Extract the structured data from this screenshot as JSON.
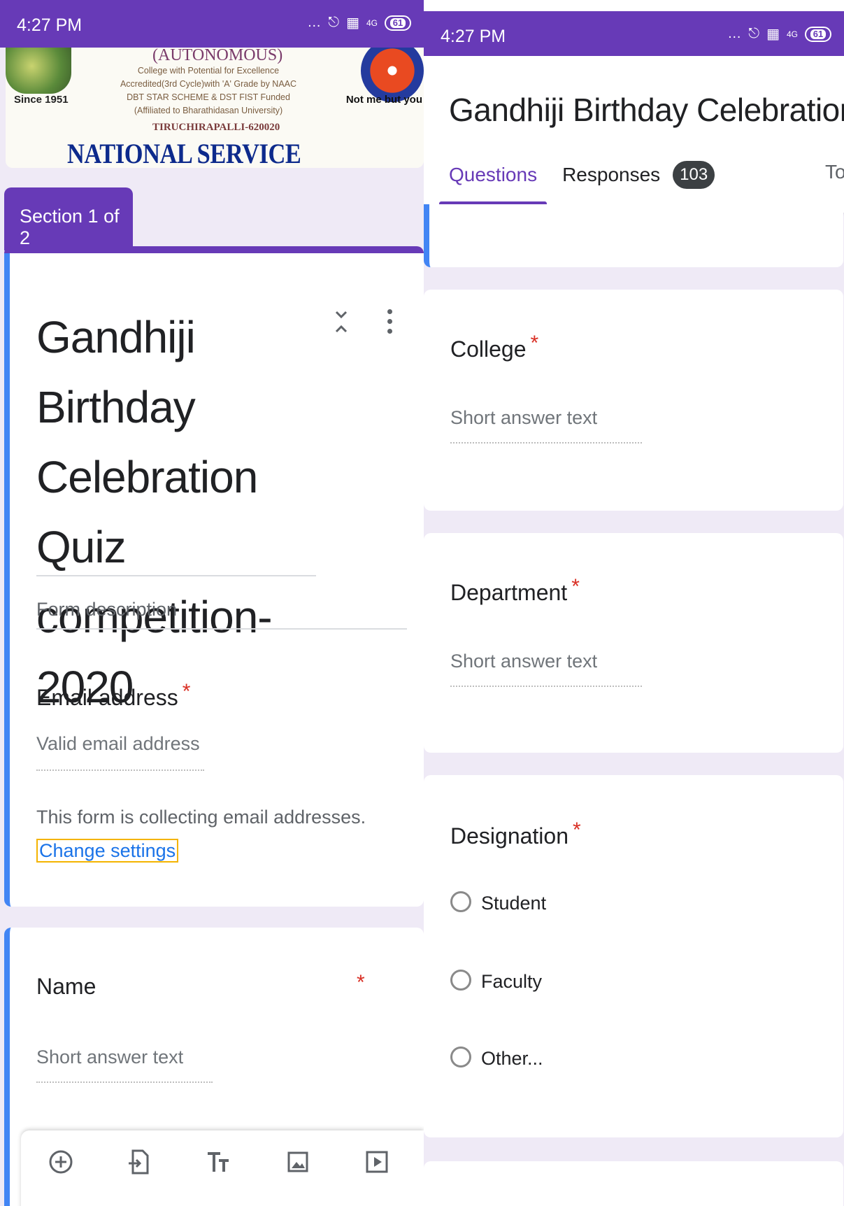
{
  "status_bar": {
    "time": "4:27 PM",
    "battery": "61",
    "network": "4G"
  },
  "banner": {
    "autonomous": "(AUTONOMOUS)",
    "lines": [
      "College with Potential for Excellence",
      "Accredited(3rd Cycle)with 'A' Grade by NAAC",
      "DBT STAR SCHEME & DST FIST Funded",
      "(Affiliated to Bharathidasan University)"
    ],
    "city": "TIRUCHIRAPALLI-620020",
    "scheme": "NATIONAL SERVICE SCHEME",
    "since": "Since 1951",
    "motto": "Not me but you"
  },
  "left": {
    "section_label": "Section 1 of 2",
    "form_title": "Gandhiji Birthday Celebration Quiz competition-2020",
    "form_description_placeholder": "Form description",
    "email_question": "Email address",
    "email_placeholder": "Valid email address",
    "notice_text": "This form is collecting email addresses.",
    "notice_link": "Change settings",
    "name_question": "Name",
    "name_placeholder": "Short answer text",
    "required_mark": "*"
  },
  "right": {
    "header_title": "Gandhiji Birthday Celebration Quiz co",
    "tabs": {
      "questions": "Questions",
      "responses": "Responses",
      "responses_count": "103",
      "total": "Tot"
    },
    "college_question": "College",
    "department_question": "Department",
    "designation_question": "Designation",
    "short_answer_placeholder": "Short answer text",
    "designation_options": [
      "Student",
      "Faculty",
      "Other..."
    ],
    "required_mark": "*"
  },
  "toolbar": {
    "icons": [
      "add-question-icon",
      "import-questions-icon",
      "add-title-icon",
      "add-image-icon",
      "add-video-icon"
    ]
  },
  "colors": {
    "accent": "#673ab7",
    "active_border": "#4285f4",
    "required": "#d93025",
    "link": "#1a73e8"
  }
}
